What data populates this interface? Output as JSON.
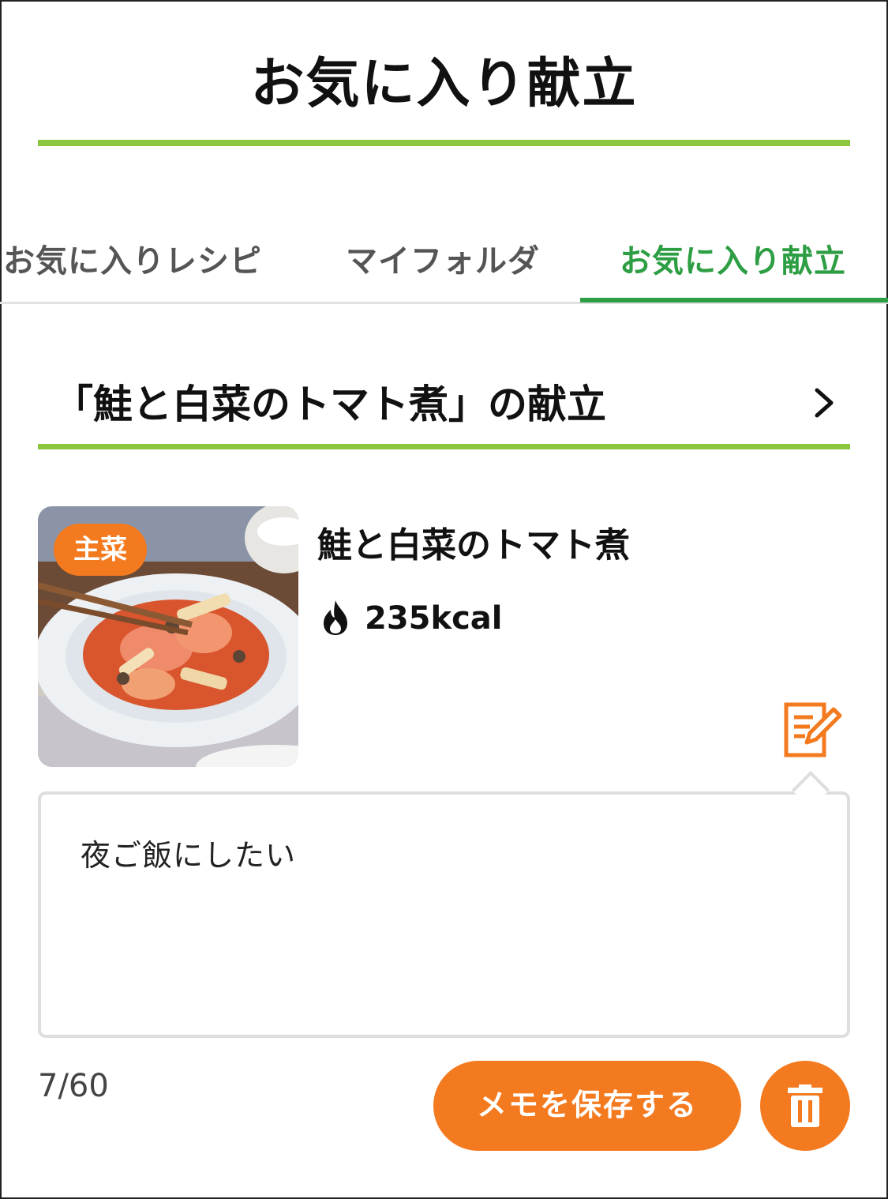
{
  "header": {
    "title": "お気に入り献立"
  },
  "tabs": [
    {
      "label": "お気に入りレシピ",
      "active": false
    },
    {
      "label": "マイフォルダ",
      "active": false
    },
    {
      "label": "お気に入り献立",
      "active": true
    }
  ],
  "menu_set": {
    "title": "「鮭と白菜のトマト煮」の献立"
  },
  "recipe": {
    "category_badge": "主菜",
    "name": "鮭と白菜のトマト煮",
    "calories": "235kcal"
  },
  "memo": {
    "text": "夜ご飯にしたい",
    "counter": "7/60",
    "save_label": "メモを保存する"
  },
  "colors": {
    "accent_green_rule": "#8cc63f",
    "active_tab_green": "#2e9e44",
    "orange": "#f47a1f"
  },
  "icons": {
    "chevron": "chevron-right-icon",
    "flame": "flame-icon",
    "memo_edit": "memo-edit-icon",
    "delete": "trash-icon"
  }
}
